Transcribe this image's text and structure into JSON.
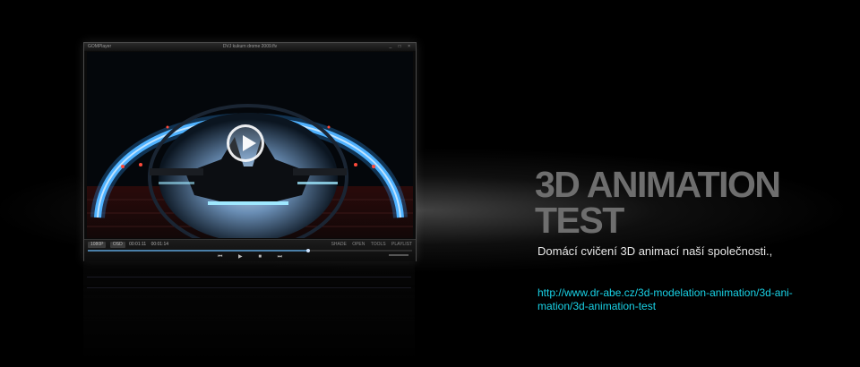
{
  "player": {
    "app_name": "GOMPlayer",
    "file_title": "DVJ kukurn drome 2009.flv",
    "window_buttons": "_ □ ×",
    "chips": [
      "1080P",
      "OSD"
    ],
    "time_current": "00:01:11",
    "time_total": "00:01:14",
    "menu": [
      "SHADE",
      "OPEN",
      "TOOLS",
      "PLAYLIST"
    ],
    "transport": [
      "⏮",
      "▶",
      "■",
      "⏭"
    ],
    "progress": 0.68,
    "accent_color": "#4a7fa8"
  },
  "headline": "3D ANIMATION TEST",
  "description": "Domácí cvičení 3D animací naší společnosti.,",
  "link": {
    "text": "http://www.dr-abe.cz/3d-modelation-animation/3d-ani-mation/3d-animation-test",
    "color": "#19d2e6"
  }
}
